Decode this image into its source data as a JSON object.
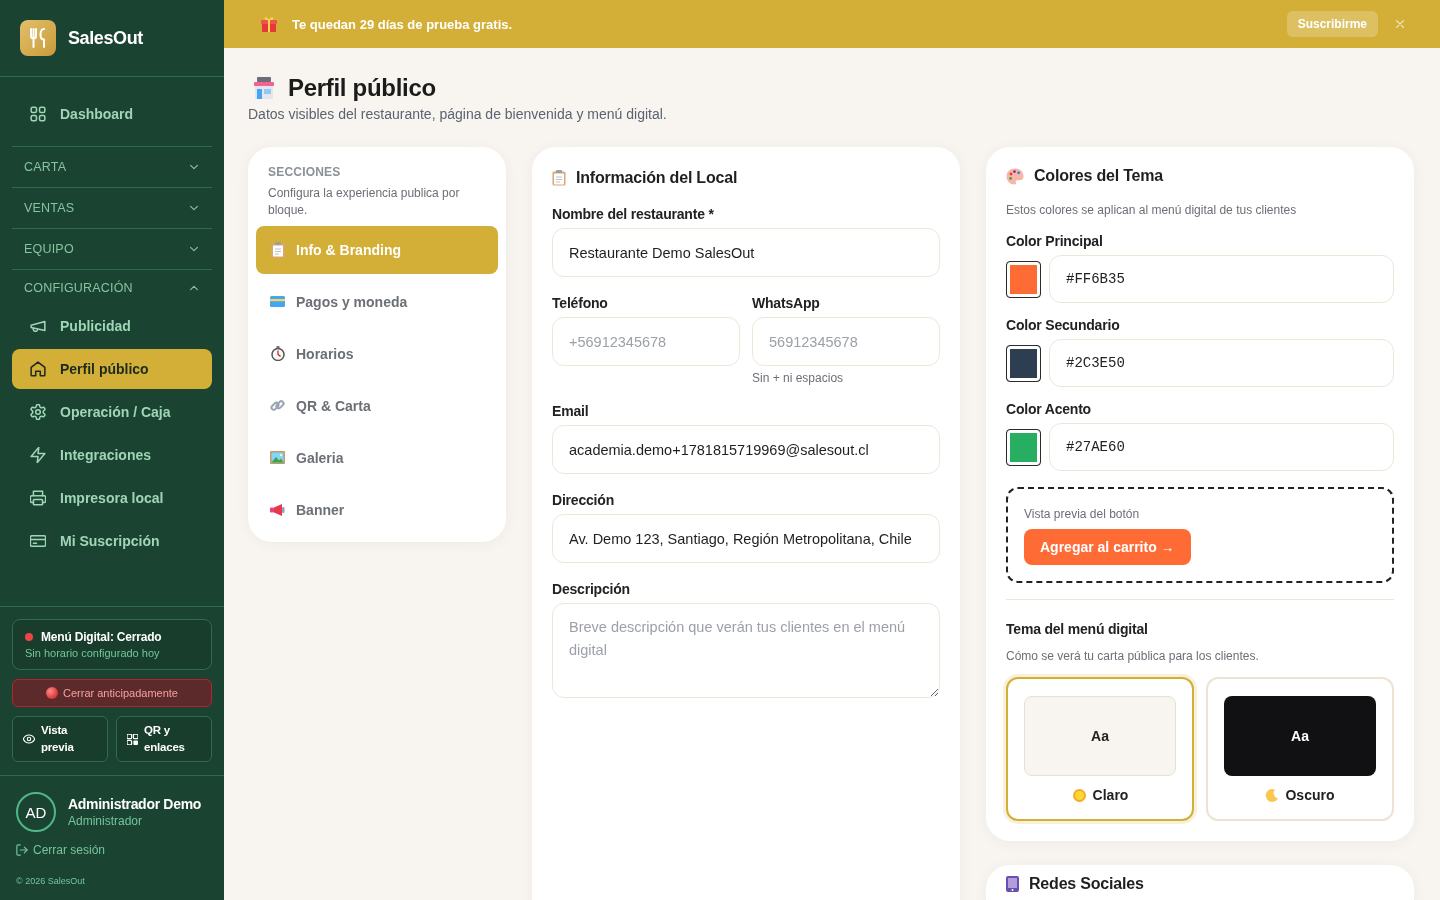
{
  "sidebar": {
    "brand": "SalesOut",
    "top_items": [
      {
        "label": "Dashboard",
        "selected": false
      }
    ],
    "groups": [
      {
        "label": "CARTA",
        "expanded": false
      },
      {
        "label": "VENTAS",
        "expanded": false
      },
      {
        "label": "EQUIPO",
        "expanded": false
      },
      {
        "label": "CONFIGURACIÓN",
        "expanded": true,
        "items": [
          {
            "label": "Publicidad",
            "selected": false
          },
          {
            "label": "Perfil público",
            "selected": true
          },
          {
            "label": "Operación / Caja",
            "selected": false
          },
          {
            "label": "Integraciones",
            "selected": false
          },
          {
            "label": "Impresora local",
            "selected": false
          },
          {
            "label": "Mi Suscripción",
            "selected": false
          }
        ]
      }
    ],
    "menu_status": {
      "title": "Menú Digital: Cerrado",
      "subtitle": "Sin horario configurado hoy",
      "open": false
    },
    "close_early_button": "Cerrar anticipadamente",
    "quick_actions": [
      "Vista previa",
      "QR y enlaces"
    ],
    "user": {
      "initials": "AD",
      "name": "Administrador Demo",
      "role": "Administrador"
    },
    "logout": "Cerrar sesión",
    "footer": "© 2026 SalesOut"
  },
  "trial_banner": {
    "message": "Te quedan 29 días de prueba gratis.",
    "button": "Suscribirme"
  },
  "page": {
    "title": "Perfil público",
    "subtitle": "Datos visibles del restaurante, página de bienvenida y menú digital."
  },
  "sections": {
    "heading": "SECCIONES",
    "description": "Configura la experiencia publica por bloque.",
    "items": [
      {
        "label": "Info & Branding",
        "selected": true
      },
      {
        "label": "Pagos y moneda",
        "selected": false
      },
      {
        "label": "Horarios",
        "selected": false
      },
      {
        "label": "QR & Carta",
        "selected": false
      },
      {
        "label": "Galeria",
        "selected": false
      },
      {
        "label": "Banner",
        "selected": false
      }
    ]
  },
  "info_card": {
    "title": "Información del Local",
    "rows": [
      {
        "fields": [
          {
            "kind": "input",
            "label": "Nombre del restaurante *",
            "value": "Restaurante Demo SalesOut"
          }
        ]
      },
      {
        "fields": [
          {
            "kind": "input",
            "label": "Teléfono",
            "placeholder": "+56912345678"
          },
          {
            "kind": "input",
            "label": "WhatsApp",
            "placeholder": "56912345678",
            "hint": "Sin + ni espacios"
          }
        ]
      },
      {
        "fields": [
          {
            "kind": "input",
            "label": "Email",
            "value": "academia.demo+1781815719969@salesout.cl"
          }
        ]
      },
      {
        "fields": [
          {
            "kind": "input",
            "label": "Dirección",
            "value": "Av. Demo 123, Santiago, Región Metropolitana, Chile"
          }
        ]
      },
      {
        "fields": [
          {
            "kind": "textarea",
            "label": "Descripción",
            "placeholder": "Breve descripción que verán tus clientes en el menú digital"
          }
        ]
      }
    ]
  },
  "theme_card": {
    "title": "Colores del Tema",
    "description": "Estos colores se aplican al menú digital de tus clientes",
    "colors": [
      {
        "label": "Color Principal",
        "value": "#FF6B35",
        "color": "#ff6b35"
      },
      {
        "label": "Color Secundario",
        "value": "#2C3E50",
        "color": "#2c3e50"
      },
      {
        "label": "Color Acento",
        "value": "#27AE60",
        "color": "#27ae60"
      }
    ],
    "preview": {
      "label": "Vista previa del botón",
      "button": "Agregar al carrito →"
    },
    "menu_theme": {
      "title": "Tema del menú digital",
      "description": "Cómo se verá tu carta pública para los clientes.",
      "options": [
        {
          "kind": "light",
          "preview": "Aa",
          "label": "Claro",
          "selected": true
        },
        {
          "kind": "dark",
          "preview": "Aa",
          "label": "Oscuro",
          "selected": false
        }
      ]
    }
  },
  "social_card": {
    "title": "Redes Sociales"
  }
}
